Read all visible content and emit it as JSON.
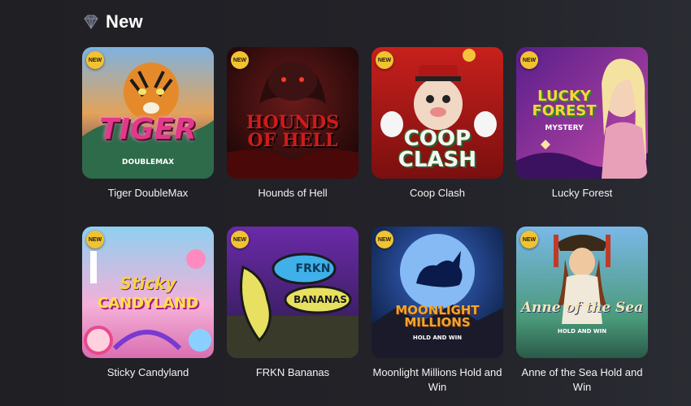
{
  "section": {
    "icon": "diamond-icon",
    "title": "New"
  },
  "badge_label": "NEW",
  "colors": {
    "background": "#222228",
    "badge": "#f2c230",
    "text": "#f4f4f4"
  },
  "games": [
    {
      "title": "Tiger DoubleMax",
      "art_text": "TIGER",
      "art_sub": "DOUBLEMAX"
    },
    {
      "title": "Hounds of Hell",
      "art_text": "HOUNDS OF HELL",
      "art_sub": ""
    },
    {
      "title": "Coop Clash",
      "art_text": "COOP CLASH",
      "art_sub": ""
    },
    {
      "title": "Lucky Forest",
      "art_text": "LUCKY FOREST",
      "art_sub": "MYSTERY"
    },
    {
      "title": "Sticky Candyland",
      "art_text": "CANDYLAND",
      "art_sub": "Sticky"
    },
    {
      "title": "FRKN Bananas",
      "art_text": "BANANAS",
      "art_sub": "FRKN"
    },
    {
      "title": "Moonlight Millions Hold and Win",
      "art_text": "MOONLIGHT MILLIONS",
      "art_sub": "HOLD AND WIN"
    },
    {
      "title": "Anne of the Sea Hold and Win",
      "art_text": "Anne of the Sea",
      "art_sub": "HOLD AND WIN"
    }
  ]
}
